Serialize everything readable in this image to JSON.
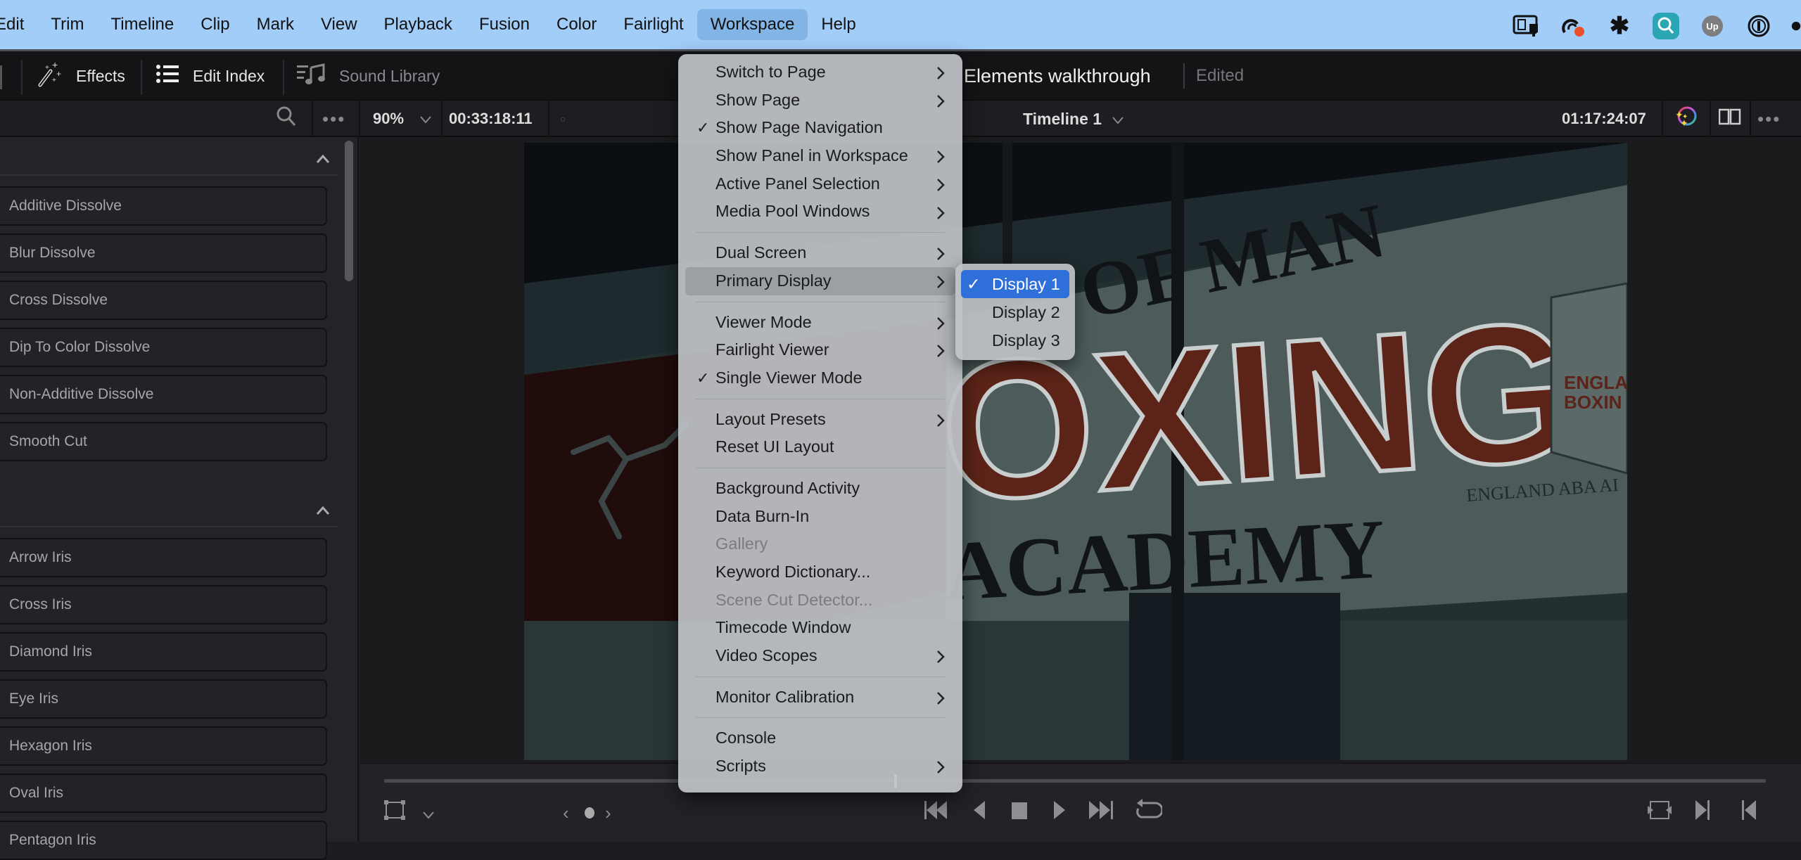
{
  "menubar": {
    "items": [
      "Edit",
      "Trim",
      "Timeline",
      "Clip",
      "Mark",
      "View",
      "Playback",
      "Fusion",
      "Color",
      "Fairlight",
      "Workspace",
      "Help"
    ],
    "active": "Workspace",
    "status_icons": [
      "display-lock-icon",
      "creative-cloud-icon",
      "perplexity-icon",
      "search-app-icon",
      "upnote-icon",
      "onepassword-icon"
    ],
    "accent": "#a2cdf8"
  },
  "toolbar": {
    "effects_label": "Effects",
    "edit_index_label": "Edit Index",
    "sound_library_label": "Sound Library",
    "project_title": "Elements walkthrough",
    "project_status": "Edited"
  },
  "viewer_bar": {
    "zoom": "90%",
    "source_timecode": "00:33:18:11",
    "timeline_name": "Timeline 1",
    "record_timecode": "01:17:24:07"
  },
  "effects_panel": {
    "sections": [
      {
        "items": [
          "Additive Dissolve",
          "Blur Dissolve",
          "Cross Dissolve",
          "Dip To Color Dissolve",
          "Non-Additive Dissolve",
          "Smooth Cut"
        ]
      },
      {
        "items": [
          "Arrow Iris",
          "Cross Iris",
          "Diamond Iris",
          "Eye Iris",
          "Hexagon Iris",
          "Oval Iris",
          "Pentagon Iris"
        ]
      }
    ]
  },
  "video_frame": {
    "sign_line1": "OF MAN",
    "sign_line2": "OXING",
    "sign_line3": "ACADEMY",
    "sign_side": "ENGLAND ABA AI",
    "badge_text1": "ENGLAN",
    "badge_text2": "BOXIN"
  },
  "transport": {
    "playhead_position": 0.37
  },
  "workspace_menu": {
    "groups": [
      [
        {
          "label": "Switch to Page",
          "submenu": true
        },
        {
          "label": "Show Page",
          "submenu": true
        },
        {
          "label": "Show Page Navigation",
          "checked": true
        },
        {
          "label": "Show Panel in Workspace",
          "submenu": true
        },
        {
          "label": "Active Panel Selection",
          "submenu": true
        },
        {
          "label": "Media Pool Windows",
          "submenu": true
        }
      ],
      [
        {
          "label": "Dual Screen",
          "submenu": true
        },
        {
          "label": "Primary Display",
          "submenu": true,
          "highlighted": true
        }
      ],
      [
        {
          "label": "Viewer Mode",
          "submenu": true
        },
        {
          "label": "Fairlight Viewer",
          "submenu": true
        },
        {
          "label": "Single Viewer Mode",
          "checked": true
        }
      ],
      [
        {
          "label": "Layout Presets",
          "submenu": true
        },
        {
          "label": "Reset UI Layout"
        }
      ],
      [
        {
          "label": "Background Activity"
        },
        {
          "label": "Data Burn-In"
        },
        {
          "label": "Gallery",
          "disabled": true
        },
        {
          "label": "Keyword Dictionary..."
        },
        {
          "label": "Scene Cut Detector...",
          "disabled": true
        },
        {
          "label": "Timecode Window"
        },
        {
          "label": "Video Scopes",
          "submenu": true
        }
      ],
      [
        {
          "label": "Monitor Calibration",
          "submenu": true
        }
      ],
      [
        {
          "label": "Console"
        },
        {
          "label": "Scripts",
          "submenu": true
        }
      ]
    ],
    "check_glyph": "✓",
    "arrow_glyph": "›"
  },
  "primary_display_submenu": {
    "items": [
      {
        "label": "Display 1",
        "checked": true,
        "selected": true
      },
      {
        "label": "Display 2"
      },
      {
        "label": "Display 3"
      }
    ],
    "selected_color": "#2f6fd9"
  }
}
